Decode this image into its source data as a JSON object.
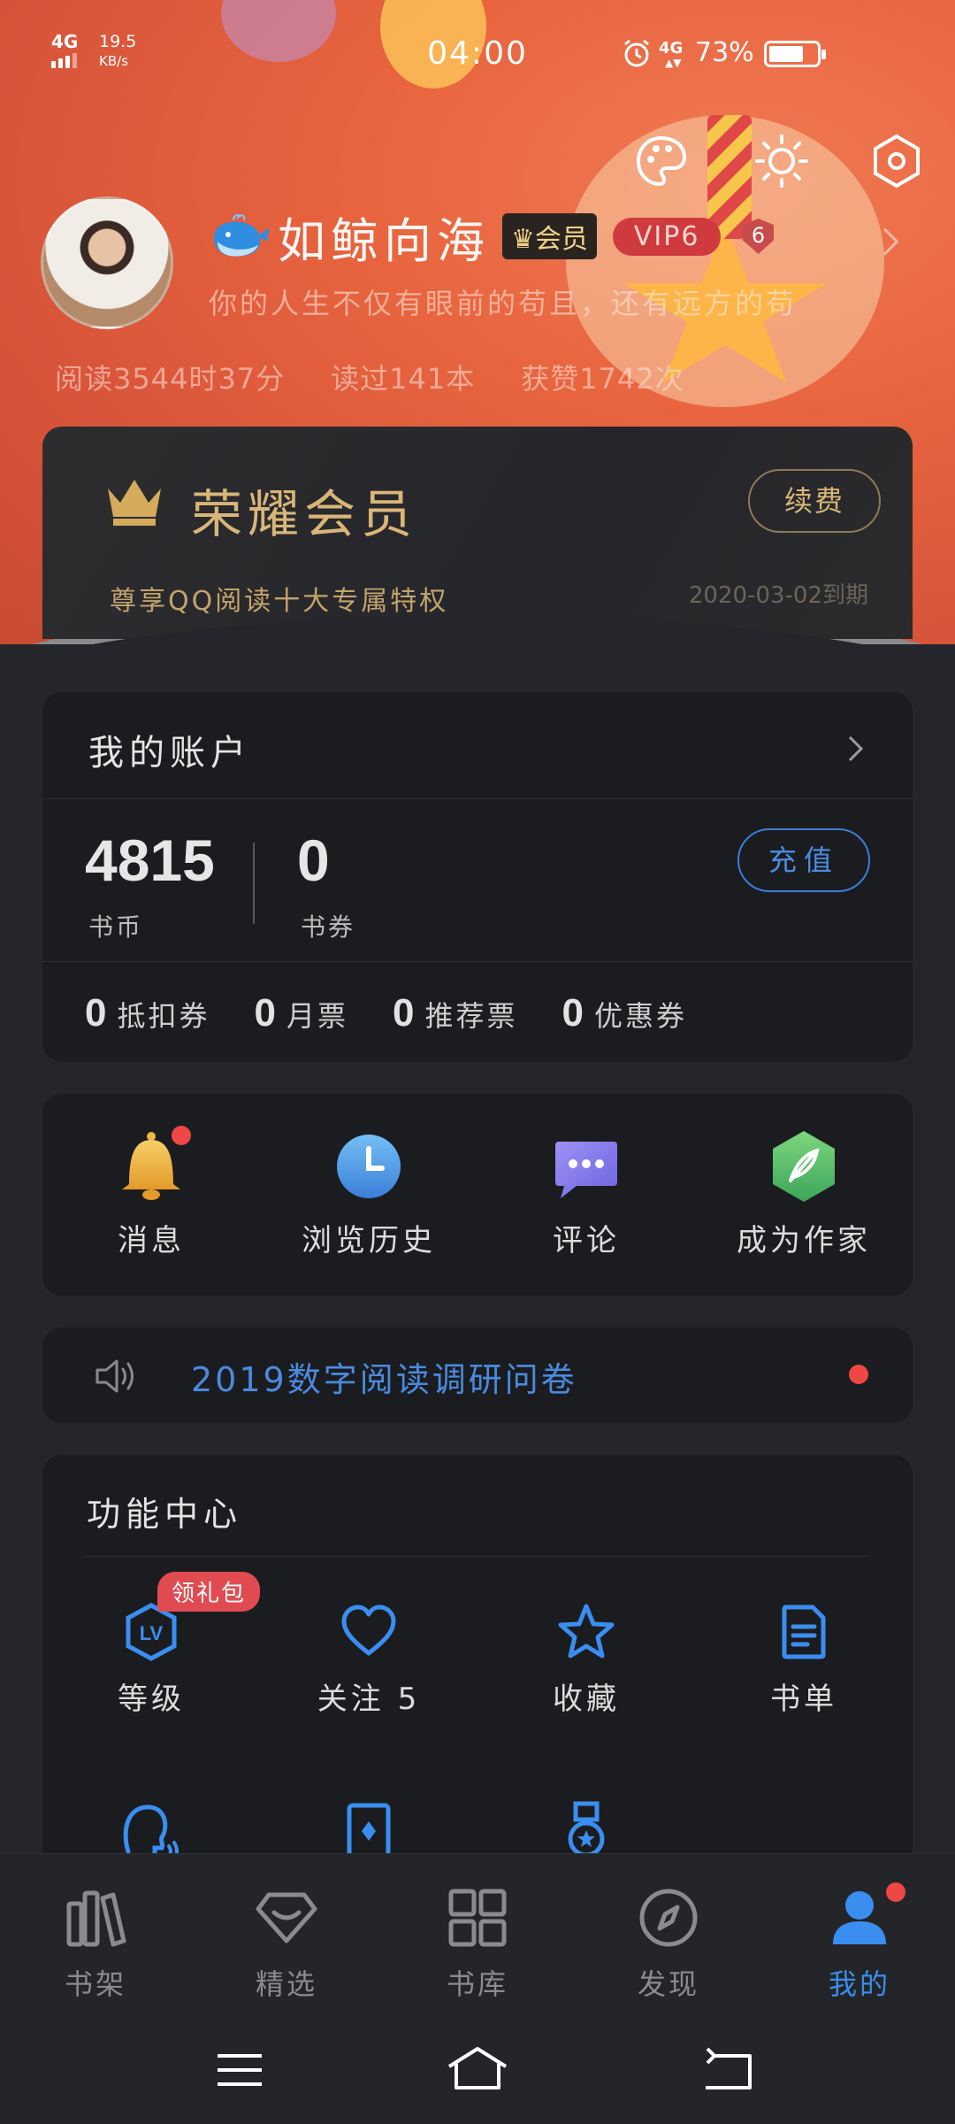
{
  "status_bar": {
    "network": "4G",
    "speed_value": "19.5",
    "speed_unit": "KB/s",
    "time": "04:00",
    "battery_text": "73%",
    "battery_level": 0.73,
    "data_network": "4G"
  },
  "header_icons": [
    "palette-icon",
    "brightness-icon",
    "settings-hex-icon"
  ],
  "profile": {
    "name": "如鲸向海",
    "member_tag": "会员",
    "vip_tag": "VIP6",
    "level": "6",
    "bio": "你的人生不仅有眼前的苟且，还有远方的苟",
    "stats": {
      "read_time": "阅读3544时37分",
      "books_read": "读过141本",
      "likes": "获赞1742次"
    }
  },
  "vip_card": {
    "title": "荣耀会员",
    "renew_label": "续费",
    "subtitle": "尊享QQ阅读十大专属特权",
    "expire": "2020-03-02到期"
  },
  "account": {
    "title": "我的账户",
    "coins_value": "4815",
    "coins_label": "书币",
    "vouchers_value": "0",
    "vouchers_label": "书券",
    "recharge_label": "充值",
    "tickets": [
      {
        "count": "0",
        "label": "抵扣券"
      },
      {
        "count": "0",
        "label": "月票"
      },
      {
        "count": "0",
        "label": "推荐票"
      },
      {
        "count": "0",
        "label": "优惠券"
      }
    ]
  },
  "shortcuts": [
    {
      "label": "消息",
      "icon": "bell-icon"
    },
    {
      "label": "浏览历史",
      "icon": "clock-icon"
    },
    {
      "label": "评论",
      "icon": "chat-bubble-icon"
    },
    {
      "label": "成为作家",
      "icon": "feather-icon"
    }
  ],
  "notice": {
    "text": "2019数字阅读调研问卷"
  },
  "features": {
    "title": "功能中心",
    "gift_badge": "领礼包",
    "items": [
      {
        "label": "等级",
        "icon": "level-icon"
      },
      {
        "label": "关注 5",
        "icon": "heart-icon"
      },
      {
        "label": "收藏",
        "icon": "star-icon"
      },
      {
        "label": "书单",
        "icon": "booklist-icon"
      }
    ],
    "row2_icons": [
      "voice-icon",
      "card-icon",
      "medal-icon"
    ]
  },
  "bottom_nav": [
    {
      "label": "书架",
      "icon": "bookshelf-icon"
    },
    {
      "label": "精选",
      "icon": "diamond-icon"
    },
    {
      "label": "书库",
      "icon": "grid-icon"
    },
    {
      "label": "发现",
      "icon": "compass-icon"
    },
    {
      "label": "我的",
      "icon": "user-icon",
      "active": true
    }
  ],
  "colors": {
    "accent_blue": "#3a8ef0",
    "gold": "#d9b678",
    "banner_orange": "#e8653f",
    "card_bg": "#1b1c20",
    "page_bg": "#24262b"
  }
}
